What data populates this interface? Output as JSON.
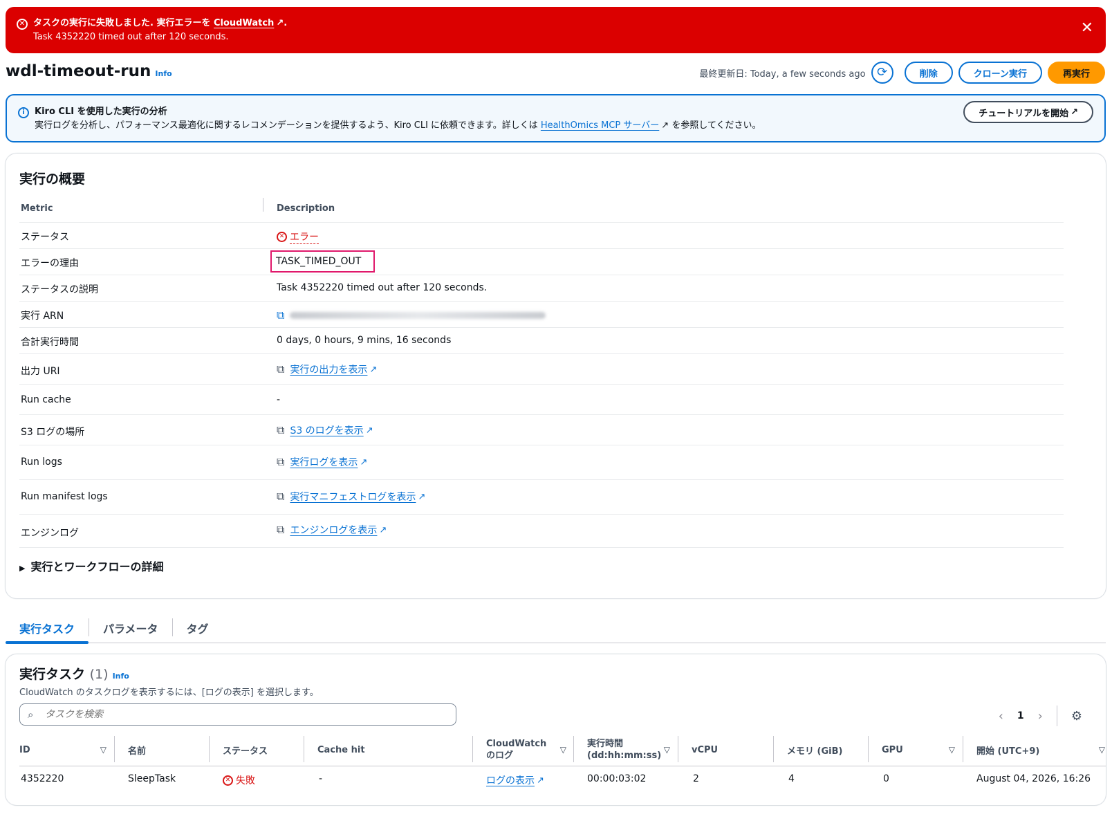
{
  "flash": {
    "title_prefix": "タスクの実行に失敗しました. 実行エラーを",
    "title_link": "CloudWatch",
    "title_suffix": ".",
    "message": "Task 4352220 timed out after 120 seconds."
  },
  "header": {
    "title": "wdl-timeout-run",
    "info": "Info",
    "last_updated": "最終更新日: Today, a few seconds ago",
    "delete_label": "削除",
    "clone_label": "クローン実行",
    "rerun_label": "再実行"
  },
  "info_alert": {
    "title": "Kiro CLI を使用した実行の分析",
    "desc_prefix": "実行ログを分析し、パフォーマンス最適化に関するレコメンデーションを提供するよう、Kiro CLI に依頼できます。詳しくは",
    "desc_link": "HealthOmics MCP サーバー",
    "desc_suffix": "を参照してください。",
    "button": "チュートリアルを開始"
  },
  "summary": {
    "title": "実行の概要",
    "col_metric": "Metric",
    "col_description": "Description",
    "rows": {
      "status": {
        "key": "ステータス",
        "value": "エラー"
      },
      "error_reason": {
        "key": "エラーの理由",
        "value": "TASK_TIMED_OUT"
      },
      "status_desc": {
        "key": "ステータスの説明",
        "value": "Task 4352220 timed out after 120 seconds."
      },
      "arn": {
        "key": "実行 ARN"
      },
      "total_time": {
        "key": "合計実行時間",
        "value": "0 days, 0 hours, 9 mins, 16 seconds"
      },
      "output_uri": {
        "key": "出力 URI",
        "link": "実行の出力を表示"
      },
      "run_cache": {
        "key": "Run cache",
        "value": "-"
      },
      "s3_logs": {
        "key": "S3 ログの場所",
        "link": "S3 のログを表示"
      },
      "run_logs": {
        "key": "Run logs",
        "link": "実行ログを表示"
      },
      "manifest_logs": {
        "key": "Run manifest logs",
        "link": "実行マニフェストログを表示"
      },
      "engine_logs": {
        "key": "エンジンログ",
        "link": "エンジンログを表示"
      }
    },
    "expander": "実行とワークフローの詳細"
  },
  "tabs": [
    "実行タスク",
    "パラメータ",
    "タグ"
  ],
  "tasks": {
    "title": "実行タスク",
    "count": "(1)",
    "info": "Info",
    "description": "CloudWatch のタスクログを表示するには、[ログの表示] を選択します。",
    "search_placeholder": "タスクを検索",
    "page": "1",
    "columns": {
      "id": "ID",
      "name": "名前",
      "status": "ステータス",
      "cache_hit": "Cache hit",
      "cw_line1": "CloudWatch",
      "cw_line2": "のログ",
      "time_line1": "実行時間",
      "time_line2": "(dd:hh:mm:ss)",
      "vcpu": "vCPU",
      "memory": "メモリ (GiB)",
      "gpu": "GPU",
      "start": "開始 (UTC+9)"
    },
    "row": {
      "id": "4352220",
      "name": "SleepTask",
      "status": "失敗",
      "cache_hit": "-",
      "logs": "ログの表示",
      "duration": "00:00:03:02",
      "vcpu": "2",
      "memory": "4",
      "gpu": "0",
      "start": "August 04, 2026, 16:26"
    }
  }
}
